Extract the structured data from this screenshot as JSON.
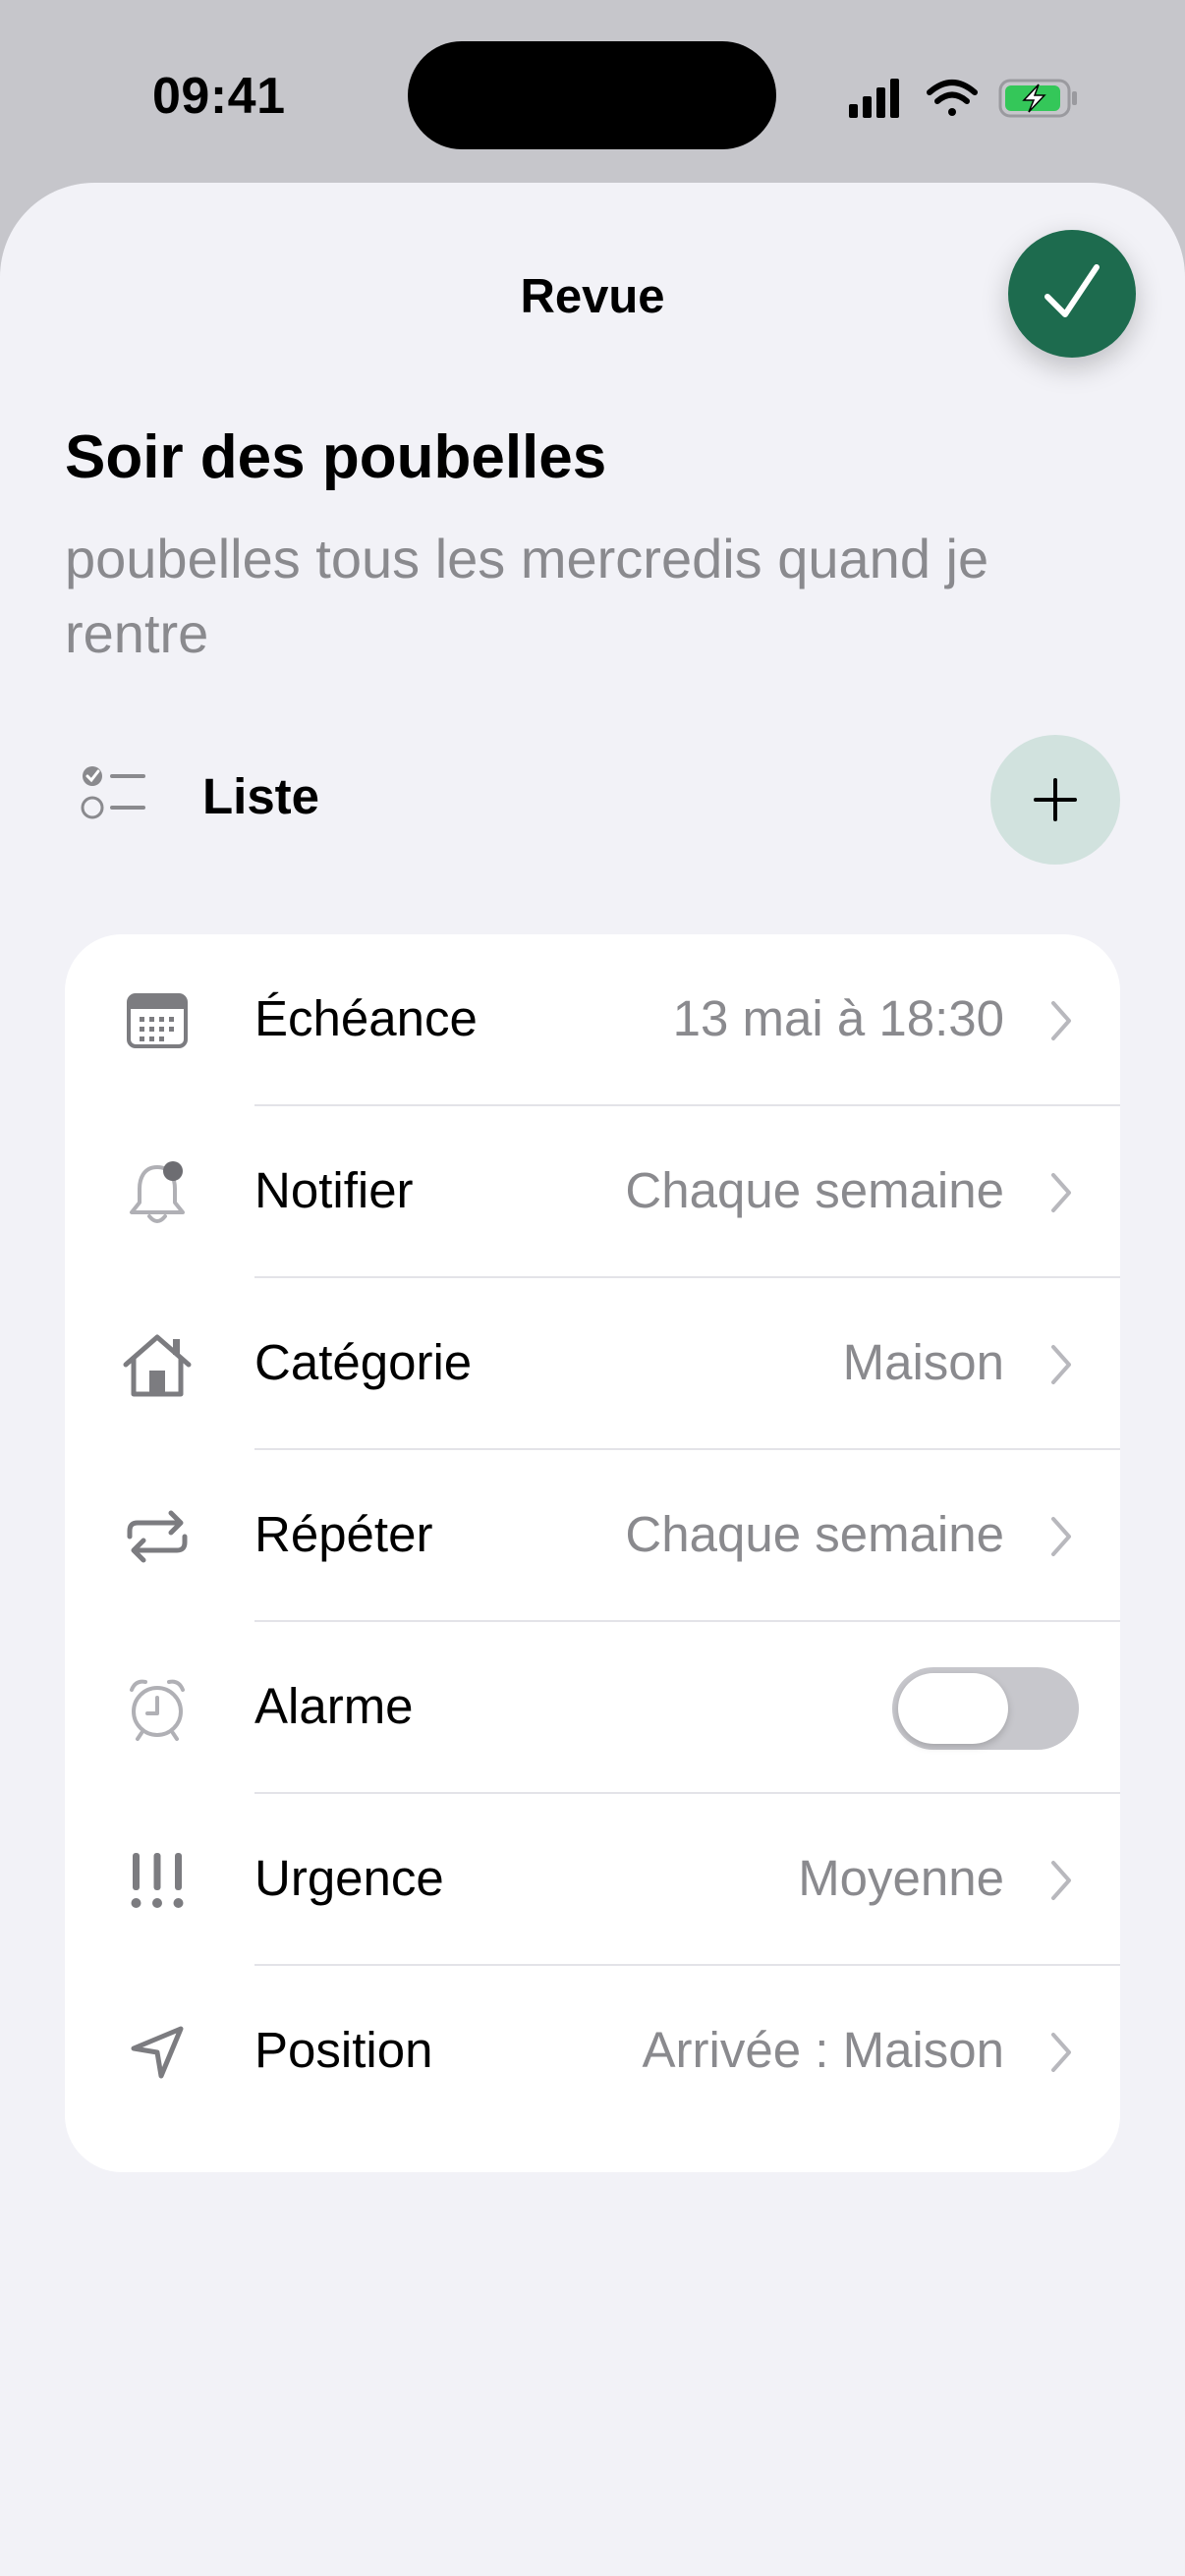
{
  "status_bar": {
    "time": "09:41"
  },
  "nav": {
    "title": "Revue"
  },
  "reminder": {
    "title": "Soir des poubelles",
    "notes": "poubelles tous les mercredis quand je rentre"
  },
  "list": {
    "label": "Liste"
  },
  "details": {
    "rows": [
      {
        "label": "Échéance",
        "value": "13 mai à 18:30",
        "icon": "calendar-icon"
      },
      {
        "label": "Notifier",
        "value": "Chaque semaine",
        "icon": "bell-icon"
      },
      {
        "label": "Catégorie",
        "value": "Maison",
        "icon": "house-icon"
      },
      {
        "label": "Répéter",
        "value": "Chaque semaine",
        "icon": "repeat-icon"
      },
      {
        "label": "Alarme",
        "toggle_on": false,
        "icon": "alarm-clock-icon"
      },
      {
        "label": "Urgence",
        "value": "Moyenne",
        "icon": "exclamation-icon"
      },
      {
        "label": "Position",
        "value": "Arrivée : Maison",
        "icon": "location-arrow-icon"
      }
    ]
  },
  "colors": {
    "accent": "#1d6b4e",
    "add_button_bg": "#d1e2de",
    "secondary_text": "#8a8a8e",
    "background": "#f2f2f7",
    "battery": "#34c759"
  }
}
